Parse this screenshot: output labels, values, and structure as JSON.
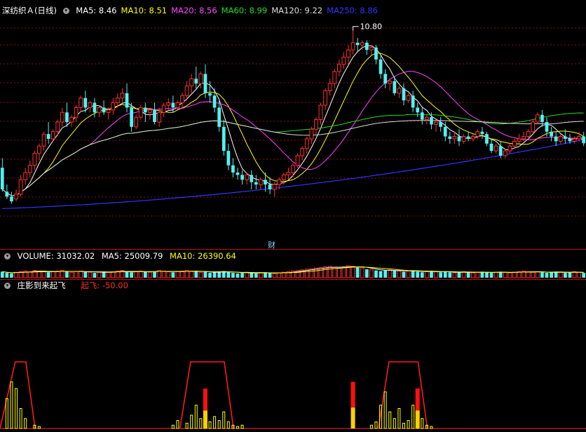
{
  "main": {
    "title": "深纺织Ａ(日线)",
    "ma": [
      {
        "label": "MA5: 8.46",
        "color": "#ffffff"
      },
      {
        "label": "MA10: 8.51",
        "color": "#ffff00"
      },
      {
        "label": "MA20: 8.56",
        "color": "#ff44ff"
      },
      {
        "label": "MA60: 8.99",
        "color": "#22dd22"
      },
      {
        "label": "MA120: 9.22",
        "color": "#dddddd"
      },
      {
        "label": "MA250: 8.86",
        "color": "#3333ff"
      }
    ],
    "high_label": "10.80",
    "fin_marker": "财"
  },
  "volume": {
    "label": "VOLUME: 31032.02",
    "ma5": "MA5: 25009.79",
    "ma10": "MA10: 26390.64"
  },
  "indicator": {
    "name": "庄影到来起飞",
    "value_label": "起飞: -50.00"
  },
  "colors": {
    "up": "#ff3030",
    "down": "#54f0f0",
    "grid": "#8a1010",
    "border": "#c01010"
  },
  "chart_data": {
    "type": "candlestick",
    "title": "深纺织Ａ(日线)",
    "price_max_label": 10.8,
    "candles": [
      [
        7.95,
        8.15,
        7.5,
        7.45
      ],
      [
        7.45,
        7.6,
        7.35,
        7.3
      ],
      [
        7.35,
        7.45,
        7.25,
        7.2
      ],
      [
        7.3,
        7.5,
        7.4,
        7.25
      ],
      [
        7.4,
        7.8,
        7.7,
        7.35
      ],
      [
        7.7,
        7.95,
        7.85,
        7.6
      ],
      [
        7.85,
        8.1,
        8.0,
        7.75
      ],
      [
        8.0,
        8.3,
        8.25,
        7.9
      ],
      [
        8.25,
        8.45,
        8.4,
        8.1
      ],
      [
        8.4,
        8.7,
        8.65,
        8.3
      ],
      [
        8.65,
        8.9,
        8.55,
        8.45
      ],
      [
        8.55,
        8.75,
        8.7,
        8.5
      ],
      [
        8.7,
        8.95,
        8.9,
        8.6
      ],
      [
        8.9,
        9.2,
        9.1,
        8.8
      ],
      [
        9.1,
        9.3,
        8.9,
        8.8
      ],
      [
        8.9,
        9.05,
        9.0,
        8.8
      ],
      [
        9.0,
        9.25,
        9.2,
        8.9
      ],
      [
        9.2,
        9.45,
        9.4,
        9.1
      ],
      [
        9.4,
        9.55,
        9.2,
        9.1
      ],
      [
        9.2,
        9.35,
        9.3,
        9.1
      ],
      [
        9.3,
        9.4,
        9.1,
        9.0
      ],
      [
        9.1,
        9.25,
        9.2,
        9.0
      ],
      [
        9.2,
        9.35,
        9.1,
        9.05
      ],
      [
        9.1,
        9.2,
        9.15,
        8.95
      ],
      [
        9.15,
        9.4,
        9.3,
        9.05
      ],
      [
        9.3,
        9.5,
        9.4,
        9.2
      ],
      [
        9.4,
        9.6,
        9.5,
        9.3
      ],
      [
        9.5,
        9.7,
        9.2,
        9.1
      ],
      [
        9.2,
        9.3,
        8.8,
        8.7
      ],
      [
        8.8,
        9.05,
        9.0,
        8.75
      ],
      [
        9.0,
        9.25,
        9.2,
        8.95
      ],
      [
        9.2,
        9.3,
        9.1,
        8.9
      ],
      [
        9.1,
        9.2,
        9.15,
        8.95
      ],
      [
        9.15,
        9.3,
        8.9,
        8.85
      ],
      [
        8.9,
        9.2,
        9.1,
        8.8
      ],
      [
        9.1,
        9.3,
        9.25,
        9.0
      ],
      [
        9.25,
        9.4,
        9.3,
        9.15
      ],
      [
        9.3,
        9.45,
        9.2,
        9.1
      ],
      [
        9.2,
        9.35,
        9.3,
        9.15
      ],
      [
        9.3,
        9.5,
        9.45,
        9.2
      ],
      [
        9.45,
        9.75,
        9.65,
        9.35
      ],
      [
        9.65,
        9.9,
        9.8,
        9.5
      ],
      [
        9.8,
        10.05,
        9.7,
        9.6
      ],
      [
        9.7,
        9.95,
        9.9,
        9.6
      ],
      [
        9.9,
        10.1,
        9.5,
        9.4
      ],
      [
        9.5,
        9.75,
        9.45,
        9.3
      ],
      [
        9.45,
        9.6,
        9.2,
        9.1
      ],
      [
        9.2,
        9.35,
        8.8,
        8.7
      ],
      [
        8.8,
        8.95,
        8.3,
        8.2
      ],
      [
        8.3,
        8.45,
        8.0,
        7.9
      ],
      [
        8.0,
        8.15,
        7.85,
        7.75
      ],
      [
        7.85,
        7.95,
        7.8,
        7.7
      ],
      [
        7.8,
        7.9,
        7.7,
        7.6
      ],
      [
        7.7,
        7.85,
        7.8,
        7.6
      ],
      [
        7.8,
        7.9,
        7.65,
        7.5
      ],
      [
        7.65,
        7.8,
        7.6,
        7.5
      ],
      [
        7.6,
        7.75,
        7.7,
        7.5
      ],
      [
        7.7,
        7.85,
        7.6,
        7.45
      ],
      [
        7.6,
        7.75,
        7.5,
        7.4
      ],
      [
        7.5,
        7.65,
        7.6,
        7.35
      ],
      [
        7.6,
        7.75,
        7.7,
        7.5
      ],
      [
        7.7,
        7.85,
        7.8,
        7.6
      ],
      [
        7.8,
        7.95,
        7.85,
        7.7
      ],
      [
        7.85,
        8.05,
        8.0,
        7.75
      ],
      [
        8.0,
        8.25,
        8.2,
        7.95
      ],
      [
        8.2,
        8.4,
        8.35,
        8.1
      ],
      [
        8.35,
        8.6,
        8.55,
        8.25
      ],
      [
        8.55,
        8.8,
        8.75,
        8.45
      ],
      [
        8.75,
        9.0,
        8.95,
        8.65
      ],
      [
        8.95,
        9.3,
        9.25,
        8.85
      ],
      [
        9.25,
        9.6,
        9.55,
        9.15
      ],
      [
        9.55,
        9.8,
        9.7,
        9.45
      ],
      [
        9.7,
        10.0,
        9.95,
        9.6
      ],
      [
        9.95,
        10.2,
        10.1,
        9.85
      ],
      [
        10.1,
        10.35,
        10.25,
        10.0
      ],
      [
        10.25,
        10.5,
        10.4,
        10.1
      ],
      [
        10.4,
        10.8,
        10.55,
        10.3
      ],
      [
        10.55,
        10.65,
        10.5,
        10.35
      ],
      [
        10.5,
        10.6,
        10.55,
        10.4
      ],
      [
        10.55,
        10.6,
        10.4,
        10.3
      ],
      [
        10.4,
        10.5,
        10.45,
        10.3
      ],
      [
        10.45,
        10.5,
        10.2,
        10.1
      ],
      [
        10.2,
        10.3,
        9.9,
        9.8
      ],
      [
        9.9,
        10.0,
        9.7,
        9.6
      ],
      [
        9.7,
        9.8,
        9.75,
        9.55
      ],
      [
        9.75,
        9.85,
        9.5,
        9.45
      ],
      [
        9.5,
        9.65,
        9.6,
        9.4
      ],
      [
        9.6,
        9.7,
        9.35,
        9.25
      ],
      [
        9.35,
        9.5,
        9.45,
        9.3
      ],
      [
        9.45,
        9.55,
        9.2,
        9.1
      ],
      [
        9.2,
        9.3,
        9.1,
        9.0
      ],
      [
        9.1,
        9.2,
        8.95,
        8.85
      ],
      [
        8.95,
        9.05,
        9.0,
        8.85
      ],
      [
        9.0,
        9.1,
        8.85,
        8.75
      ],
      [
        8.85,
        8.95,
        8.9,
        8.7
      ],
      [
        8.9,
        9.0,
        8.8,
        8.7
      ],
      [
        8.8,
        8.9,
        8.6,
        8.5
      ],
      [
        8.6,
        8.7,
        8.55,
        8.45
      ],
      [
        8.55,
        8.7,
        8.6,
        8.45
      ],
      [
        8.6,
        8.75,
        8.5,
        8.4
      ],
      [
        8.5,
        8.65,
        8.6,
        8.45
      ],
      [
        8.6,
        8.7,
        8.55,
        8.5
      ],
      [
        8.55,
        8.65,
        8.6,
        8.5
      ],
      [
        8.6,
        8.75,
        8.7,
        8.55
      ],
      [
        8.7,
        8.8,
        8.65,
        8.55
      ],
      [
        8.65,
        8.7,
        8.45,
        8.4
      ],
      [
        8.45,
        8.55,
        8.3,
        8.25
      ],
      [
        8.3,
        8.45,
        8.4,
        8.25
      ],
      [
        8.4,
        8.5,
        8.2,
        8.15
      ],
      [
        8.2,
        8.35,
        8.3,
        8.15
      ],
      [
        8.3,
        8.45,
        8.4,
        8.25
      ],
      [
        8.4,
        8.55,
        8.5,
        8.35
      ],
      [
        8.5,
        8.65,
        8.55,
        8.45
      ],
      [
        8.55,
        8.7,
        8.6,
        8.5
      ],
      [
        8.6,
        8.75,
        8.7,
        8.55
      ],
      [
        8.7,
        8.95,
        8.9,
        8.65
      ],
      [
        8.9,
        9.1,
        9.05,
        8.85
      ],
      [
        9.05,
        9.15,
        8.9,
        8.8
      ],
      [
        8.9,
        9.0,
        8.7,
        8.6
      ],
      [
        8.7,
        8.8,
        8.6,
        8.5
      ],
      [
        8.6,
        8.7,
        8.5,
        8.4
      ],
      [
        8.5,
        8.65,
        8.6,
        8.45
      ],
      [
        8.6,
        8.75,
        8.55,
        8.45
      ],
      [
        8.55,
        8.65,
        8.5,
        8.45
      ],
      [
        8.5,
        8.6,
        8.55,
        8.45
      ],
      [
        8.55,
        8.7,
        8.6,
        8.5
      ],
      [
        8.6,
        8.7,
        8.46,
        8.4
      ]
    ],
    "volume_bars": [
      0.5,
      0.4,
      0.35,
      0.45,
      0.5,
      0.55,
      0.5,
      0.6,
      0.55,
      0.5,
      0.45,
      0.5,
      0.55,
      0.6,
      0.5,
      0.45,
      0.5,
      0.55,
      0.5,
      0.45,
      0.4,
      0.45,
      0.5,
      0.45,
      0.5,
      0.55,
      0.6,
      0.5,
      0.45,
      0.5,
      0.55,
      0.5,
      0.45,
      0.5,
      0.6,
      0.55,
      0.5,
      0.45,
      0.5,
      0.55,
      0.6,
      0.55,
      0.5,
      0.45,
      0.5,
      0.4,
      0.45,
      0.5,
      0.55,
      0.45,
      0.4,
      0.35,
      0.4,
      0.45,
      0.4,
      0.35,
      0.4,
      0.45,
      0.4,
      0.35,
      0.4,
      0.45,
      0.5,
      0.55,
      0.6,
      0.65,
      0.7,
      0.75,
      0.8,
      0.85,
      0.9,
      0.95,
      0.85,
      0.8,
      0.9,
      1.0,
      0.95,
      0.85,
      0.8,
      0.7,
      0.65,
      0.6,
      0.55,
      0.6,
      0.65,
      0.6,
      0.55,
      0.5,
      0.55,
      0.6,
      0.5,
      0.45,
      0.5,
      0.55,
      0.5,
      0.45,
      0.5,
      0.45,
      0.4,
      0.45,
      0.5,
      0.45,
      0.4,
      0.45,
      0.5,
      0.45,
      0.4,
      0.45,
      0.5,
      0.45,
      0.4,
      0.45,
      0.5,
      0.55,
      0.5,
      0.45,
      0.5,
      0.45,
      0.4,
      0.45,
      0.5,
      0.45,
      0.4,
      0.45,
      0.5,
      0.45,
      0.4
    ],
    "indicator_trapezoids": [
      [
        0,
        3,
        5,
        7
      ],
      [
        39,
        41,
        48,
        50
      ],
      [
        82,
        84,
        90,
        92
      ]
    ],
    "indicator_yellow": [
      [
        1,
        0.45
      ],
      [
        2,
        0.7
      ],
      [
        3,
        0.6
      ],
      [
        4,
        0.3
      ],
      [
        5,
        0.15
      ],
      [
        7,
        0.05
      ],
      [
        8,
        0.03
      ],
      [
        37,
        0.05
      ],
      [
        38,
        0.12
      ],
      [
        40,
        0.08
      ],
      [
        41,
        0.2
      ],
      [
        42,
        0.35
      ],
      [
        43,
        0.15
      ],
      [
        44,
        0.05
      ],
      [
        45,
        0.1
      ],
      [
        46,
        0.18
      ],
      [
        47,
        0.12
      ],
      [
        48,
        0.25
      ],
      [
        49,
        0.1
      ],
      [
        50,
        0.05
      ],
      [
        51,
        0.03
      ],
      [
        52,
        0.05
      ],
      [
        80,
        0.05
      ],
      [
        81,
        0.1
      ],
      [
        82,
        0.35
      ],
      [
        83,
        0.55
      ],
      [
        84,
        0.25
      ],
      [
        85,
        0.15
      ],
      [
        86,
        0.3
      ],
      [
        87,
        0.08
      ],
      [
        88,
        0.12
      ],
      [
        89,
        0.35
      ],
      [
        90,
        0.5
      ],
      [
        91,
        0.15
      ],
      [
        92,
        0.05
      ],
      [
        93,
        0.03
      ]
    ],
    "indicator_signals": [
      [
        44,
        0.6
      ],
      [
        76,
        0.7
      ],
      [
        90,
        0.6
      ]
    ]
  }
}
